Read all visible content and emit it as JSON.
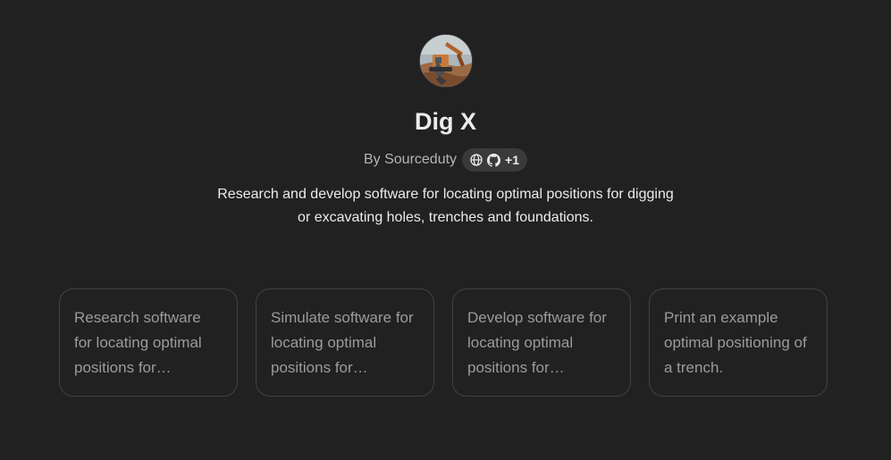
{
  "gpt": {
    "name": "Dig X",
    "byline": "By Sourceduty",
    "links_extra": "+1",
    "description": "Research and develop software for locating optimal positions for digging or excavating holes, trenches and foundations."
  },
  "icons": {
    "avatar": "excavator-photo",
    "website": "globe-icon",
    "github": "github-icon"
  },
  "starters": [
    {
      "text": "Research software for locating optimal positions for…"
    },
    {
      "text": "Simulate software for locating optimal positions for…"
    },
    {
      "text": "Develop software for locating optimal positions for…"
    },
    {
      "text": "Print an example optimal positioning of a trench."
    }
  ],
  "colors": {
    "background": "#212121",
    "card_border": "#424242",
    "pill_bg": "#3a3a3a"
  }
}
